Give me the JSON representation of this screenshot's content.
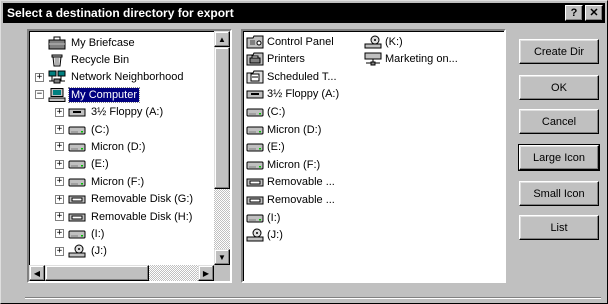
{
  "window": {
    "title": "Select a destination directory for export",
    "help_label": "?",
    "close_label": "✕"
  },
  "tree": {
    "items": [
      {
        "label": "My Briefcase",
        "icon": "briefcase-icon",
        "expander": ""
      },
      {
        "label": "Recycle Bin",
        "icon": "recycle-bin-icon",
        "expander": ""
      },
      {
        "label": "Network Neighborhood",
        "icon": "network-icon",
        "expander": "+"
      },
      {
        "label": "My Computer",
        "icon": "computer-icon",
        "expander": "−",
        "selected": true
      },
      {
        "label": "3½ Floppy (A:)",
        "icon": "floppy-drive-icon",
        "expander": "+"
      },
      {
        "label": "(C:)",
        "icon": "hard-drive-icon",
        "expander": "+"
      },
      {
        "label": "Micron (D:)",
        "icon": "hard-drive-icon",
        "expander": "+"
      },
      {
        "label": "(E:)",
        "icon": "hard-drive-icon",
        "expander": "+"
      },
      {
        "label": "Micron (F:)",
        "icon": "hard-drive-icon",
        "expander": "+"
      },
      {
        "label": "Removable Disk (G:)",
        "icon": "removable-disk-icon",
        "expander": "+"
      },
      {
        "label": "Removable Disk (H:)",
        "icon": "removable-disk-icon",
        "expander": "+"
      },
      {
        "label": "(I:)",
        "icon": "hard-drive-icon",
        "expander": "+"
      },
      {
        "label": "(J:)",
        "icon": "cdrom-drive-icon",
        "expander": "+"
      }
    ]
  },
  "list": {
    "column1": [
      {
        "label": "Control Panel",
        "icon": "control-panel-icon"
      },
      {
        "label": "Printers",
        "icon": "printers-folder-icon"
      },
      {
        "label": "Scheduled T...",
        "icon": "scheduled-tasks-icon"
      },
      {
        "label": "3½ Floppy (A:)",
        "icon": "floppy-drive-icon"
      },
      {
        "label": "(C:)",
        "icon": "hard-drive-icon"
      },
      {
        "label": "Micron (D:)",
        "icon": "hard-drive-icon"
      },
      {
        "label": "(E:)",
        "icon": "hard-drive-icon"
      },
      {
        "label": "Micron (F:)",
        "icon": "hard-drive-icon"
      },
      {
        "label": "Removable ...",
        "icon": "removable-disk-icon"
      },
      {
        "label": "Removable ...",
        "icon": "removable-disk-icon"
      },
      {
        "label": "(I:)",
        "icon": "hard-drive-icon"
      },
      {
        "label": "(J:)",
        "icon": "cdrom-drive-icon"
      }
    ],
    "column2": [
      {
        "label": "(K:)",
        "icon": "cdrom-drive-icon"
      },
      {
        "label": "Marketing on...",
        "icon": "network-drive-icon"
      }
    ]
  },
  "buttons": {
    "create_dir": "Create Dir",
    "ok": "OK",
    "cancel": "Cancel",
    "large_icon": "Large Icon",
    "small_icon": "Small Icon",
    "list": "List"
  },
  "scroll": {
    "up_arrow": "▲",
    "down_arrow": "▼",
    "left_arrow": "◀",
    "right_arrow": "▶"
  }
}
